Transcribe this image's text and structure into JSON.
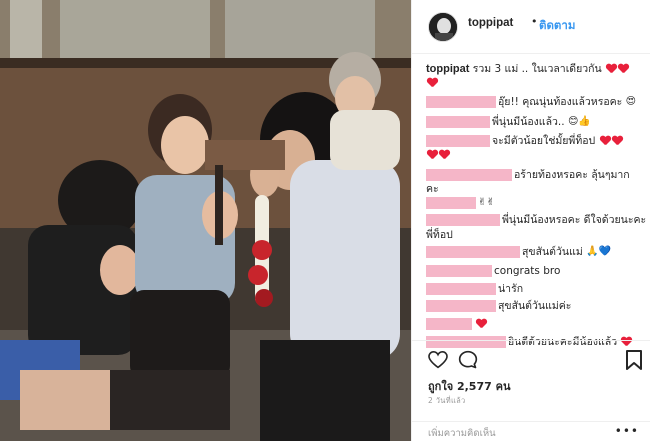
{
  "header": {
    "username": "toppipat",
    "separator": "•",
    "follow_label": "ติดตาม"
  },
  "caption": {
    "username": "toppipat",
    "text": "รวม 3 แม่ .. ในเวลาเดียวกัน"
  },
  "comments": [
    {
      "text": "อุ๊ย!! คุณนุ่นท้องแล้วหรอคะ",
      "emoji": "😍"
    },
    {
      "text": "พี่นุ่นมีน้องแล้ว..",
      "emoji": "😊👍"
    },
    {
      "text": "จะมีตัวน้อยใช่มั้ยพี่ท็อป",
      "emoji": ""
    },
    {
      "text": "อร้ายท้องหรอคะ ลุ้นๆมาก",
      "text2": "คะ"
    },
    {
      "text": "",
      "emoji": "✌✌"
    },
    {
      "text": "พี่นุ่นมีน้องหรอคะ ดีใจด้วยนะคะ",
      "text2": "พี่ท็อป"
    },
    {
      "text": "สุขสันต์วันแม่",
      "emoji": "🙏💙"
    },
    {
      "text": "congrats bro"
    },
    {
      "text": "น่ารัก"
    },
    {
      "text": "สุขสันต์วันแม่ค่ะ"
    },
    {
      "text": "",
      "emoji": "❤"
    },
    {
      "text": "ยินดีด้วยนะคะมีน้องแล้ว",
      "emoji": "❤"
    }
  ],
  "stats": {
    "likes": "ถูกใจ 2,577 คน",
    "time": "2 วันที่แล้ว"
  },
  "add_comment": {
    "placeholder": "เพิ่มความคิดเห็น",
    "more": "•••"
  },
  "colors": {
    "accent": "#3897f0",
    "mask": "#f5b6c8",
    "heart": "#e8203b"
  },
  "icons": [
    "heart-icon",
    "comment-icon",
    "bookmark-icon",
    "more-icon"
  ]
}
